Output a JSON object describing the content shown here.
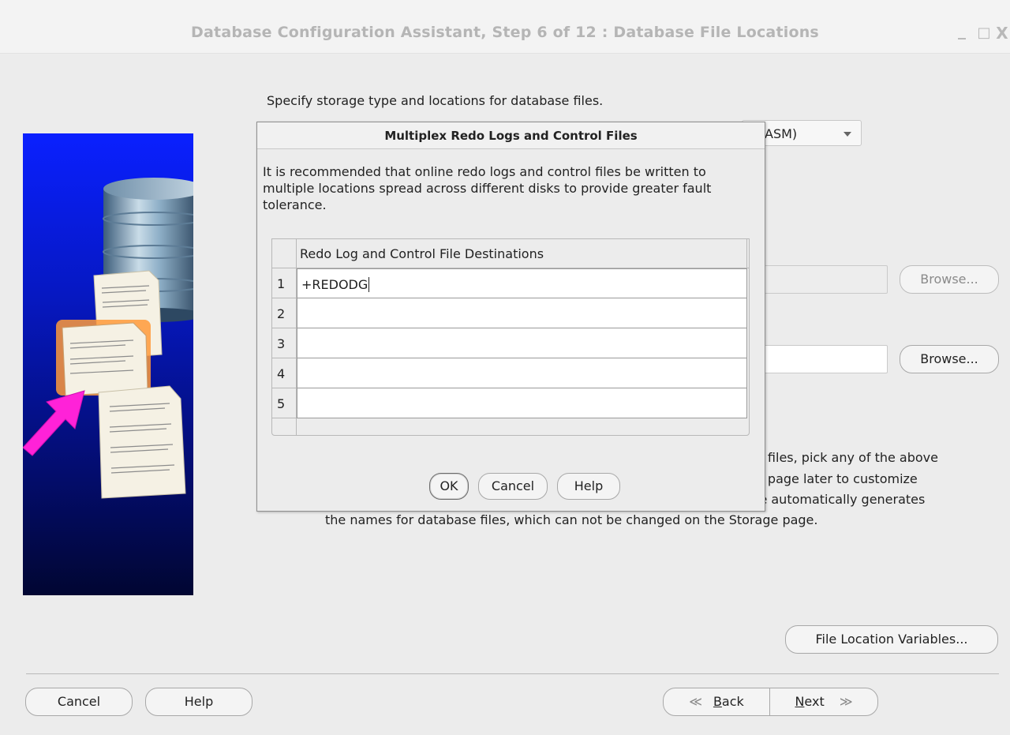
{
  "window": {
    "title": "Database Configuration Assistant, Step 6 of 12 : Database File Locations",
    "minimize_glyph": "_",
    "maximize_glyph": "□",
    "close_glyph": "X"
  },
  "main": {
    "instruction": "Specify storage type and locations for database files.",
    "storage_type_combo_visible": "ASM)",
    "browse_1": "Browse...",
    "browse_2": "Browse...",
    "para_line1_visible": "e files, pick any of the above",
    "para_line2_visible": "e page later to customize",
    "para_line3_visible": "le automatically generates",
    "para_line4": "the names for database files, which can not be changed on the Storage page.",
    "file_location_variables": "File Location Variables..."
  },
  "footer": {
    "cancel": "Cancel",
    "help": "Help",
    "back_glyph": "≪",
    "back_mnemonic": "B",
    "back_rest": "ack",
    "next_mnemonic": "N",
    "next_rest": "ext",
    "next_glyph": "≫"
  },
  "dialog": {
    "title": "Multiplex Redo Logs and Control Files",
    "description": "It is recommended that online redo logs and control files be written to multiple locations spread across different disks to provide greater fault tolerance.",
    "table": {
      "header": "Redo Log and Control File Destinations",
      "rows": [
        {
          "num": "1",
          "value": "+REDODG"
        },
        {
          "num": "2",
          "value": ""
        },
        {
          "num": "3",
          "value": ""
        },
        {
          "num": "4",
          "value": ""
        },
        {
          "num": "5",
          "value": ""
        }
      ]
    },
    "ok": "OK",
    "cancel": "Cancel",
    "help": "Help"
  },
  "colors": {
    "side_panel_top": "#0a20ff",
    "side_panel_bottom": "#010632",
    "arrow_magenta": "#ff22d8",
    "highlight_orange": "#ff9a3a"
  }
}
